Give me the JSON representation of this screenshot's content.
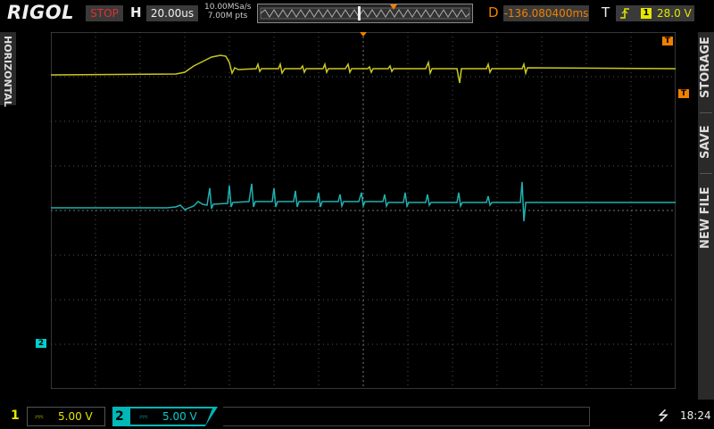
{
  "header": {
    "brand": "RIGOL",
    "run_state": "STOP",
    "horizontal_label": "H",
    "timebase": "20.00us",
    "sample_rate": "10.00MSa/s",
    "memory_depth": "7.00M pts",
    "delay_label": "D",
    "delay_value": "-136.080400ms",
    "trigger_label": "T",
    "trigger_edge_icon": "rising-edge-icon",
    "trigger_source": "1",
    "trigger_level": "28.0 V"
  },
  "left_menu": {
    "label": "HORIZONTAL"
  },
  "right_menu": {
    "items": [
      "STORAGE",
      "SAVE",
      "NEW FILE"
    ]
  },
  "markers": {
    "trigger_top": "T",
    "trigger_right": "T",
    "ch2_ground": "2"
  },
  "channels": [
    {
      "num": "1",
      "coupling_icon": "dc-icon",
      "scale": "5.00 V",
      "color": "#e6e600"
    },
    {
      "num": "2",
      "coupling_icon": "dc-icon",
      "scale": "5.00 V",
      "color": "#00d0d0"
    }
  ],
  "status_bar": {
    "usb_icon": "usb-icon",
    "time": "18:24"
  },
  "colors": {
    "ch1": "#c8c820",
    "ch2": "#20b0b0",
    "accent_orange": "#f08000",
    "grid": "#6a6a6a"
  }
}
